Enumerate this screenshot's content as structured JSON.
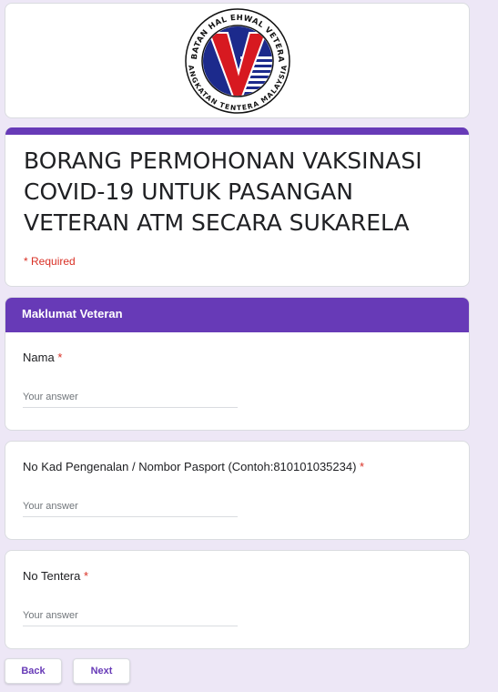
{
  "logo": {
    "top_text": "JABATAN HAL EHWAL VETERAN",
    "bottom_text": "ANGKATAN TENTERA MALAYSIA",
    "letter": "V"
  },
  "form": {
    "title": "BORANG PERMOHONAN VAKSINASI COVID-19 UNTUK PASANGAN VETERAN ATM SECARA SUKARELA",
    "required_note": "* Required"
  },
  "section": {
    "header": "Maklumat Veteran"
  },
  "questions": [
    {
      "label": "Nama",
      "star": "*",
      "placeholder": "Your answer"
    },
    {
      "label": "No Kad Pengenalan / Nombor Pasport (Contoh:810101035234)",
      "star": "*",
      "placeholder": "Your answer"
    },
    {
      "label": "No Tentera",
      "star": "*",
      "placeholder": "Your answer"
    }
  ],
  "nav": {
    "back": "Back",
    "next": "Next"
  },
  "colors": {
    "accent": "#673ab7",
    "background": "#ede7f6",
    "required": "#d93025",
    "logo_blue": "#1c2a8c",
    "logo_red": "#d71920"
  }
}
